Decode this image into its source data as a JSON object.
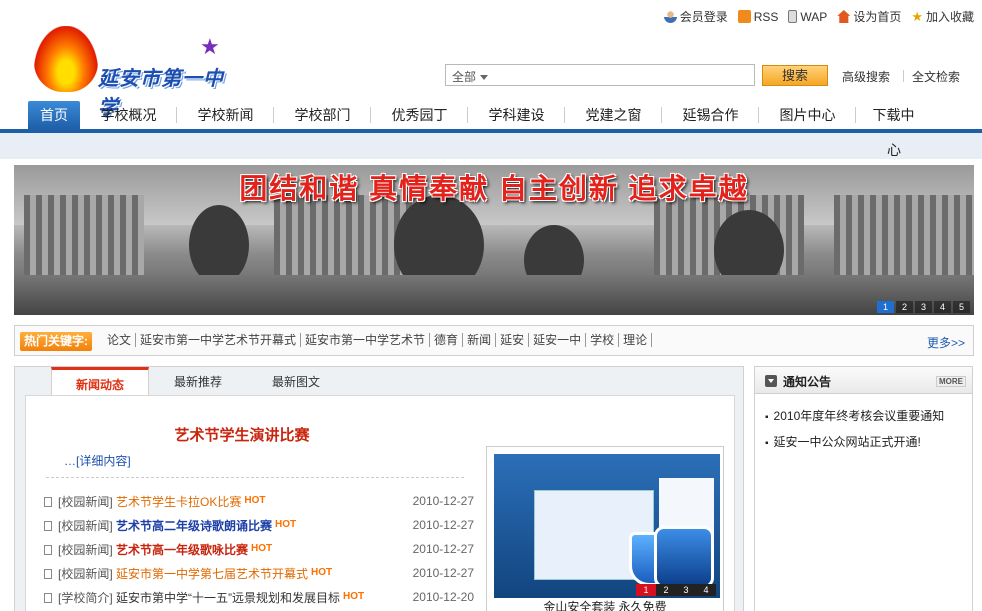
{
  "top_links": {
    "login": "会员登录",
    "rss": "RSS",
    "wap": "WAP",
    "set_home": "设为首页",
    "favorite": "加入收藏"
  },
  "logo": {
    "name": "延安市第一中学"
  },
  "search": {
    "scope": "全部",
    "button": "搜索",
    "advanced": "高级搜索",
    "fulltext": "全文检索"
  },
  "nav": {
    "items": [
      "首页",
      "学校概况",
      "学校新闻",
      "学校部门",
      "优秀园丁",
      "学科建设",
      "党建之窗",
      "延锡合作",
      "图片中心",
      "下载中"
    ],
    "wrap": "心"
  },
  "banner": {
    "slogan": "团结和谐 真情奉献 自主创新 追求卓越",
    "pages": [
      "1",
      "2",
      "3",
      "4",
      "5"
    ]
  },
  "hot": {
    "label": "热门关键字:",
    "keywords": [
      "论文",
      "延安市第一中学艺术节开幕式",
      "延安市第一中学艺术节",
      "德育",
      "新闻",
      "延安",
      "延安一中",
      "学校",
      "理论"
    ],
    "more": "更多>>"
  },
  "news": {
    "tabs": [
      "新闻动态",
      "最新推荐",
      "最新图文"
    ],
    "headline": "艺术节学生演讲比赛",
    "detail": "…[详细内容]",
    "items": [
      {
        "cat": "[校园新闻]",
        "title": "艺术节学生卡拉OK比赛",
        "hot": "HOT",
        "date": "2010-12-27"
      },
      {
        "cat": "[校园新闻]",
        "title": "艺术节高二年级诗歌朗诵比赛",
        "hot": "HOT",
        "date": "2010-12-27"
      },
      {
        "cat": "[校园新闻]",
        "title": "艺术节高一年级歌咏比赛",
        "hot": "HOT",
        "date": "2010-12-27"
      },
      {
        "cat": "[校园新闻]",
        "title": "延安市第一中学第七届艺术节开幕式",
        "hot": "HOT",
        "date": "2010-12-27"
      },
      {
        "cat": "[学校简介]",
        "title": "延安市第中学“十一五”远景规划和发展目标",
        "hot": "HOT",
        "date": "2010-12-20"
      }
    ],
    "promo": {
      "caption": "金山安全套装 永久免费",
      "pages": [
        "1",
        "2",
        "3",
        "4"
      ]
    }
  },
  "notice": {
    "title": "通知公告",
    "more": "MORE",
    "items": [
      "2010年度年终考核会议重要通知",
      "延安一中公众网站正式开通!"
    ]
  }
}
